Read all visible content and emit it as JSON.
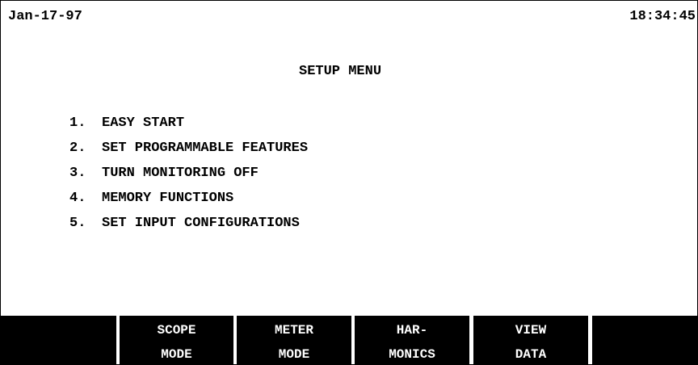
{
  "header": {
    "date": "Jan-17-97",
    "time": "18:34:45"
  },
  "menu": {
    "title": "SETUP MENU",
    "items": [
      {
        "number": "1.",
        "label": "EASY START"
      },
      {
        "number": "2.",
        "label": "SET PROGRAMMABLE FEATURES"
      },
      {
        "number": "3.",
        "label": "TURN MONITORING OFF"
      },
      {
        "number": "4.",
        "label": "MEMORY FUNCTIONS"
      },
      {
        "number": "5.",
        "label": "SET INPUT CONFIGURATIONS"
      }
    ]
  },
  "softkeys": [
    {
      "line1": "",
      "line2": ""
    },
    {
      "line1": "SCOPE",
      "line2": "MODE"
    },
    {
      "line1": "METER",
      "line2": "MODE"
    },
    {
      "line1": "HAR-",
      "line2": "MONICS"
    },
    {
      "line1": "VIEW",
      "line2": "DATA"
    },
    {
      "line1": "",
      "line2": ""
    }
  ],
  "colors": {
    "background": "#ffffff",
    "text": "#000000",
    "softkey_background": "#000000",
    "softkey_text": "#ffffff"
  }
}
